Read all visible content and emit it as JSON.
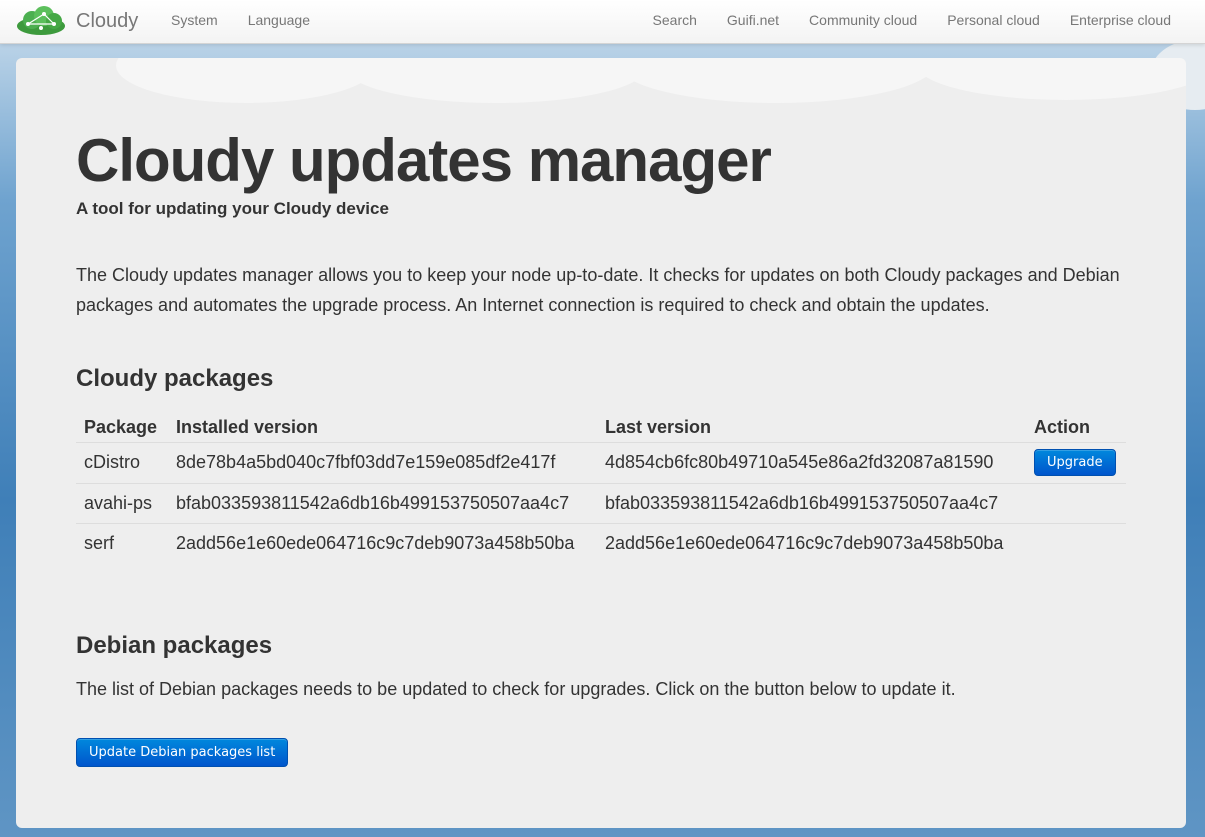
{
  "navbar": {
    "brand": "Cloudy",
    "left_items": [
      {
        "label": "System",
        "name": "nav-item-system"
      },
      {
        "label": "Language",
        "name": "nav-item-language"
      }
    ],
    "right_items": [
      {
        "label": "Search",
        "name": "nav-item-search"
      },
      {
        "label": "Guifi.net",
        "name": "nav-item-guifi"
      },
      {
        "label": "Community cloud",
        "name": "nav-item-community-cloud"
      },
      {
        "label": "Personal cloud",
        "name": "nav-item-personal-cloud"
      },
      {
        "label": "Enterprise cloud",
        "name": "nav-item-enterprise-cloud"
      }
    ]
  },
  "hero": {
    "title": "Cloudy updates manager",
    "subtitle": "A tool for updating your Cloudy device",
    "intro": "The Cloudy updates manager allows you to keep your node up-to-date. It checks for updates on both Cloudy packages and Debian packages and automates the upgrade process. An Internet connection is required to check and obtain the updates."
  },
  "cloudy_packages": {
    "heading": "Cloudy packages",
    "columns": [
      "Package",
      "Installed version",
      "Last version",
      "Action"
    ],
    "rows": [
      {
        "package": "cDistro",
        "installed": "8de78b4a5bd040c7fbf03dd7e159e085df2e417f",
        "last": "4d854cb6fc80b49710a545e86a2fd32087a81590",
        "action": "Upgrade"
      },
      {
        "package": "avahi-ps",
        "installed": "bfab033593811542a6db16b499153750507aa4c7",
        "last": "bfab033593811542a6db16b499153750507aa4c7",
        "action": ""
      },
      {
        "package": "serf",
        "installed": "2add56e1e60ede064716c9c7deb9073a458b50ba",
        "last": "2add56e1e60ede064716c9c7deb9073a458b50ba",
        "action": ""
      }
    ]
  },
  "debian_packages": {
    "heading": "Debian packages",
    "text": "The list of Debian packages needs to be updated to check for upgrades. Click on the button below to update it.",
    "button": "Update Debian packages list"
  },
  "colors": {
    "accent": "#0066cc",
    "hero_background": "#eeeeee",
    "nav_text": "#777777"
  }
}
